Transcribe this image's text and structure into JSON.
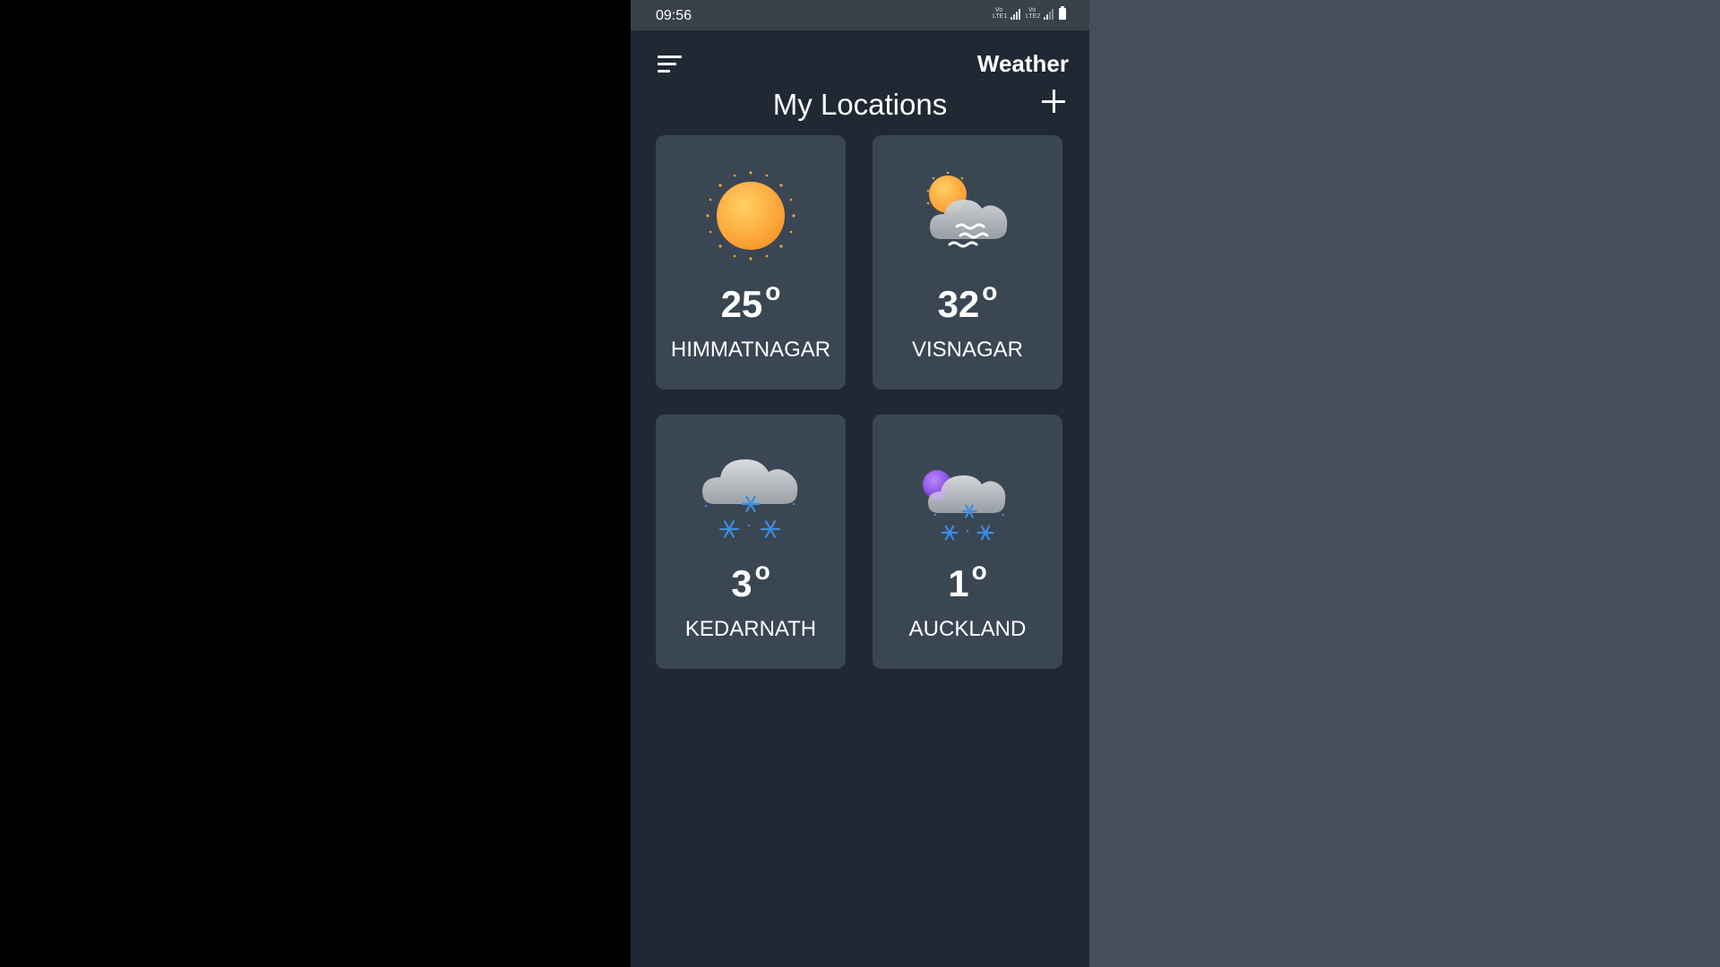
{
  "status_bar": {
    "time": "09:56",
    "network_1": "VoLTE1",
    "network_2": "VoLTE2"
  },
  "header": {
    "title": "Weather",
    "menu_icon": "menu-icon"
  },
  "section": {
    "title": "My Locations",
    "add_icon": "plus-icon"
  },
  "locations": [
    {
      "temperature": "25",
      "unit": "o",
      "city": "HIMMATNAGAR",
      "condition_icon": "sunny-icon"
    },
    {
      "temperature": "32",
      "unit": "o",
      "city": "VISNAGAR",
      "condition_icon": "sun-fog-icon"
    },
    {
      "temperature": "3",
      "unit": "o",
      "city": "KEDARNATH",
      "condition_icon": "snow-icon"
    },
    {
      "temperature": "1",
      "unit": "o",
      "city": "AUCKLAND",
      "condition_icon": "night-snow-icon"
    }
  ],
  "colors": {
    "phone_bg": "#202933",
    "status_bar_bg": "#39414b",
    "card_bg": "#3b4653",
    "right_bg": "#454e59",
    "sun": "#fca23a",
    "snowflake": "#3b8ede",
    "moon": "#8e4ee8"
  }
}
